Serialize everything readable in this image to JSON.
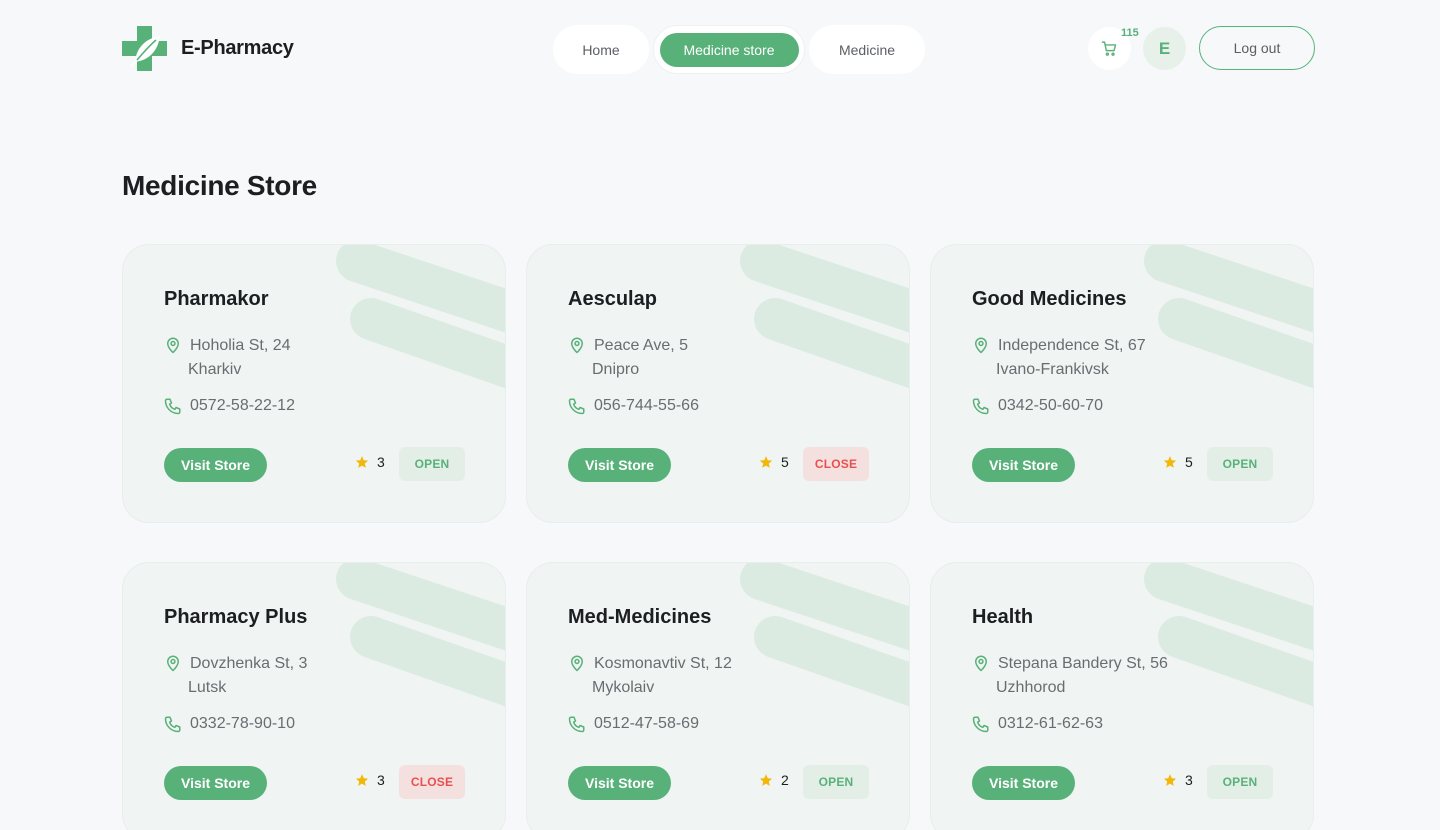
{
  "brand": {
    "name": "E-Pharmacy",
    "accent": "#59b17a"
  },
  "nav": {
    "home": "Home",
    "medicine_store": "Medicine store",
    "medicine": "Medicine"
  },
  "header": {
    "cart_icon": "cart-icon",
    "cart_count": "115",
    "avatar_initial": "E",
    "logout": "Log out"
  },
  "page": {
    "title": "Medicine Store"
  },
  "stores": [
    {
      "name": "Pharmakor",
      "street": "Hoholia St, 24",
      "city": "Kharkiv",
      "phone": "0572-58-22-12",
      "visit": "Visit Store",
      "rating": "3",
      "status": "OPEN",
      "open": true
    },
    {
      "name": "Aesculap",
      "street": "Peace Ave, 5",
      "city": "Dnipro",
      "phone": "056-744-55-66",
      "visit": "Visit Store",
      "rating": "5",
      "status": "CLOSE",
      "open": false
    },
    {
      "name": "Good Medicines",
      "street": "Independence St, 67",
      "city": "Ivano-Frankivsk",
      "phone": "0342-50-60-70",
      "visit": "Visit Store",
      "rating": "5",
      "status": "OPEN",
      "open": true
    },
    {
      "name": "Pharmacy Plus",
      "street": "Dovzhenka St, 3",
      "city": "Lutsk",
      "phone": "0332-78-90-10",
      "visit": "Visit Store",
      "rating": "3",
      "status": "CLOSE",
      "open": false
    },
    {
      "name": "Med-Medicines",
      "street": "Kosmonavtiv St, 12",
      "city": "Mykolaiv",
      "phone": "0512-47-58-69",
      "visit": "Visit Store",
      "rating": "2",
      "status": "OPEN",
      "open": true
    },
    {
      "name": "Health",
      "street": "Stepana Bandery St, 56",
      "city": "Uzhhorod",
      "phone": "0312-61-62-63",
      "visit": "Visit Store",
      "rating": "3",
      "status": "OPEN",
      "open": true
    }
  ]
}
